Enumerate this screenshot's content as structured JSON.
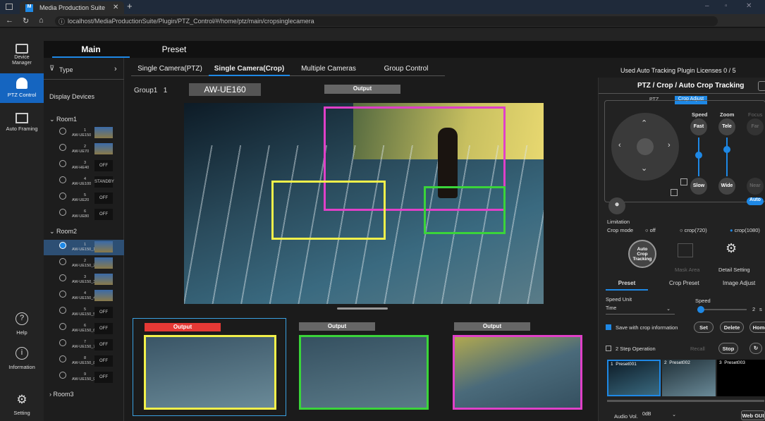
{
  "browser": {
    "tab_title": "Media Production Suite",
    "url": "localhost/MediaProductionSuite/Plugin/PTZ_Control/#/home/ptz/main/cropsinglecamera"
  },
  "rail": {
    "items": [
      {
        "label": "Device Manager"
      },
      {
        "label": "PTZ Control"
      },
      {
        "label": "Auto Framing"
      },
      {
        "label": "Help"
      },
      {
        "label": "Information"
      },
      {
        "label": "Setting"
      }
    ]
  },
  "topnav": {
    "main": "Main",
    "preset": "Preset"
  },
  "devices": {
    "type_label": "Type",
    "title": "Display Devices",
    "room1": "Room1",
    "room2": "Room2",
    "room3": "Room3",
    "room1_cams": [
      {
        "num": "1",
        "name": "AW-UE150",
        "state": ""
      },
      {
        "num": "2",
        "name": "AW-UE70",
        "state": ""
      },
      {
        "num": "3",
        "name": "AW-HE40",
        "state": "OFF"
      },
      {
        "num": "4",
        "name": "AW-UE100",
        "state": "STANDBY"
      },
      {
        "num": "5",
        "name": "AW-UE20",
        "state": "OFF"
      },
      {
        "num": "6",
        "name": "AW-UE80",
        "state": "OFF"
      }
    ],
    "room2_cams": [
      {
        "num": "1",
        "name": "AW-UE150_1",
        "state": ""
      },
      {
        "num": "2",
        "name": "AW-UE150_2",
        "state": ""
      },
      {
        "num": "3",
        "name": "AW-UE150_3",
        "state": ""
      },
      {
        "num": "4",
        "name": "AW-UE150_4",
        "state": ""
      },
      {
        "num": "5",
        "name": "AW-UE150_5",
        "state": "OFF"
      },
      {
        "num": "6",
        "name": "AW-UE150_6",
        "state": "OFF"
      },
      {
        "num": "7",
        "name": "AW-UE150_7",
        "state": "OFF"
      },
      {
        "num": "8",
        "name": "AW-UE150_8",
        "state": "OFF"
      },
      {
        "num": "9",
        "name": "AW-UE150_9",
        "state": "OFF"
      }
    ]
  },
  "camtabs": [
    "Single Camera(PTZ)",
    "Single Camera(Crop)",
    "Multiple Cameras",
    "Group Control"
  ],
  "license": "Used Auto Tracking Plugin Licenses  0 / 5",
  "group": {
    "label": "Group1",
    "num": "1",
    "camera": "AW-UE160",
    "output": "Output"
  },
  "outputs": [
    "Output",
    "Output",
    "Output"
  ],
  "colors": {
    "magenta": "#e040c8",
    "yellow": "#f2f04a",
    "green": "#3ad43a",
    "accent": "#1e88e5",
    "output_red": "#e53935"
  },
  "right": {
    "title": "PTZ / Crop / Auto Crop Tracking",
    "tab_ptz": "PTZ",
    "tab_crop": "Crop Adjust",
    "speed": "Speed",
    "zoom": "Zoom",
    "focus": "Focus",
    "fast": "Fast",
    "tele": "Tele",
    "far": "Far",
    "slow": "Slow",
    "wide": "Wide",
    "near": "Near",
    "auto": "Auto",
    "limitation": "Limitation",
    "crop_mode": "Crop mode",
    "off": "off",
    "crop720": "crop(720)",
    "crop1080": "crop(1080)",
    "auto_crop": "Auto Crop Tracking",
    "mask_area": "Mask Area",
    "detail_setting": "Detail Setting",
    "preset": "Preset",
    "crop_preset": "Crop Preset",
    "image_adjust": "Image Adjust",
    "speed_unit": "Speed Unit",
    "speed_label": "Speed",
    "time": "Time",
    "speed_value": "2",
    "speed_unit_s": "s",
    "save_crop": "Save with crop information",
    "set": "Set",
    "delete": "Delete",
    "home": "Home",
    "two_step": "2 Step Operation",
    "recall": "Recall",
    "stop": "Stop",
    "presets": [
      {
        "num": "1",
        "name": "Preset001"
      },
      {
        "num": "2",
        "name": "Preset002"
      },
      {
        "num": "3",
        "name": "Preset003"
      }
    ],
    "audio_vol": "Audio Vol.",
    "audio_val": "0dB",
    "webgui": "Web GUI"
  }
}
